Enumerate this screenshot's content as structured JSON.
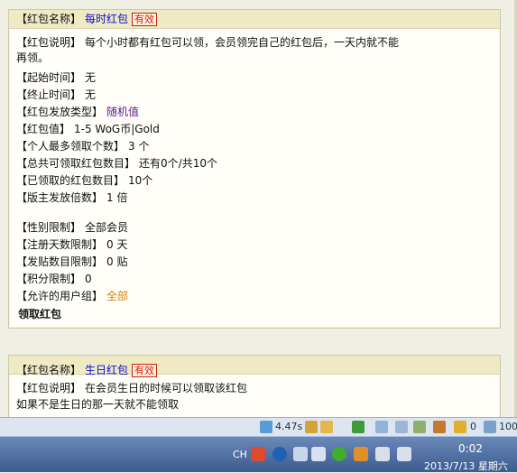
{
  "packet1": {
    "name_label": "【红包名称】",
    "name_value": "每时红包",
    "status_badge": "有效",
    "desc_label": "【红包说明】",
    "desc_value": "每个小时都有红包可以领，会员领完自己的红包后，一天内就不能",
    "desc_value_cont": "再领。",
    "start_label": "【起始时间】",
    "start_value": "无",
    "end_label": "【终止时间】",
    "end_value": "无",
    "type_label": "【红包发放类型】",
    "type_value": "随机值",
    "amount_label": "【红包值】",
    "amount_value": "1-5  WoG币|Gold",
    "max_label": "【个人最多领取个数】",
    "max_value": "3 个",
    "total_label": "【总共可领取红包数目】",
    "total_value": "还有0个/共10个",
    "claimed_label": "【已领取的红包数目】",
    "claimed_value": "10个",
    "multiplier_label": "【版主发放倍数】",
    "multiplier_value": "1 倍",
    "gender_label": "【性别限制】",
    "gender_value": "全部会员",
    "regdays_label": "【注册天数限制】",
    "regdays_value": "0 天",
    "posts_label": "【发贴数目限制】",
    "posts_value": "0 贴",
    "points_label": "【积分限制】",
    "points_value": "0",
    "groups_label": "【允许的用户组】",
    "groups_value": "全部",
    "claim_button": "领取红包"
  },
  "packet2": {
    "name_label": "【红包名称】",
    "name_value": "生日红包",
    "status_badge": "有效",
    "desc_label": "【红包说明】",
    "desc_value": "在会员生日的时候可以领取该红包",
    "desc_value_cont": "如果不是生日的那一天就不能领取"
  },
  "statusbar": {
    "load_time": "4.47s",
    "counter_a": "0",
    "zoom": "100"
  },
  "taskbar": {
    "lang": "CH",
    "time": "0:02",
    "date": "2013/7/13 星期六"
  },
  "colors": {
    "link_blue": "#0a0ad0",
    "purple": "#5b1696",
    "orange": "#d98000",
    "badge_red": "#cc2200"
  }
}
